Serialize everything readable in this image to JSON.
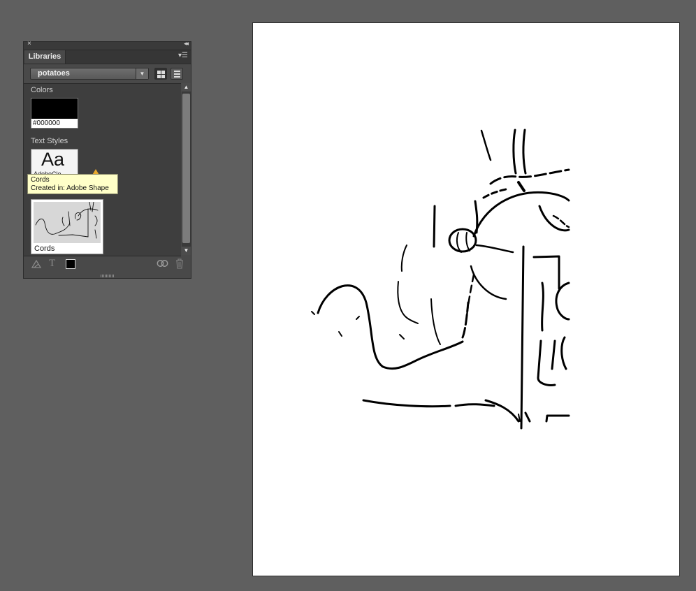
{
  "panel": {
    "close_glyph": "×",
    "collapse_glyph": "◂◂",
    "tab_label": "Libraries",
    "menu_glyph": "▾☰",
    "library_selected": "potatoes",
    "dropdown_glyph": "▼",
    "sections": {
      "colors_label": "Colors",
      "color_hex": "#000000",
      "text_styles_label": "Text Styles",
      "text_style_sample": "Aa",
      "text_style_name": "AdobeCle",
      "graphic_name": "Cords"
    },
    "scroll": {
      "up_glyph": "▲",
      "down_glyph": "▼"
    },
    "footer": {
      "add_graphic_icon": "graphic-add-icon",
      "text_glyph": "T",
      "cc_glyph": "⊚",
      "trash_glyph": "🗑"
    }
  },
  "tooltip": {
    "line1": "Cords",
    "line2": "Created in: Adobe Shape"
  },
  "colors": {
    "workspace": "#5f5f5f",
    "panel": "#494949",
    "tooltip": "#ffffc8",
    "artboard": "#ffffff",
    "stroke": "#000000"
  }
}
